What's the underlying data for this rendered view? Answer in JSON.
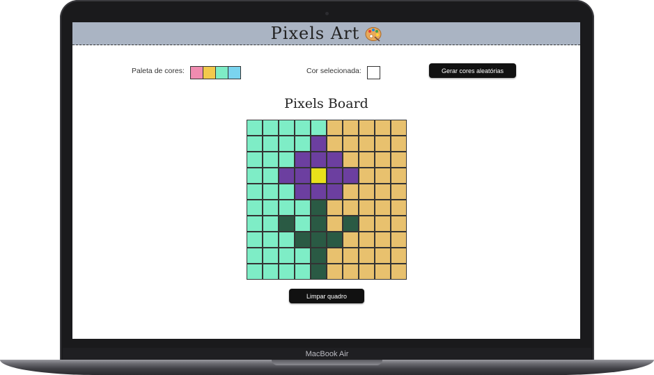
{
  "device": {
    "brand_label": "MacBook Air"
  },
  "app": {
    "title": "Pixels Art",
    "title_icon": "artist-palette-icon",
    "palette_label": "Paleta de cores:",
    "palette_colors": [
      "#f08cb0",
      "#f2c94c",
      "#7eedc6",
      "#7ad4ee"
    ],
    "selected_label": "Cor selecionada:",
    "selected_color": "#ffffff",
    "random_button_label": "Gerar cores aleatórias",
    "board_title": "Pixels Board",
    "clear_button_label": "Limpar quadro",
    "colors": {
      "header_bg": "#aab4c3",
      "button_bg": "#111111"
    }
  },
  "board": {
    "legend": {
      "T": "#7eedc6",
      "O": "#e8c16e",
      "P": "#6c3fa0",
      "Y": "#e8e11a",
      "G": "#2a5a44"
    },
    "rows": [
      "TTTTTOOOOO",
      "TTTTPOOOOO",
      "TTTPPPOOOO",
      "TTPPYPPOOO",
      "TTTPPPOOOO",
      "TTTTGOOOOO",
      "TTGTGOGOOO",
      "TTTGGGOOOO",
      "TTTTGOOOOO",
      "TTTTGOOOOO"
    ]
  }
}
